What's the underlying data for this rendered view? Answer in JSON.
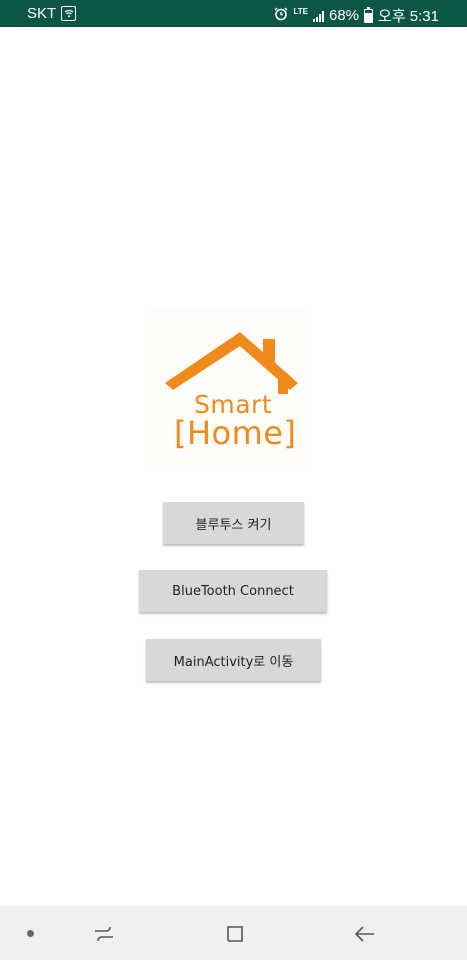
{
  "status_bar": {
    "carrier": "SKT",
    "network": "LTE",
    "battery": "68%",
    "battery_level": 0.68,
    "time": "오후 5:31",
    "icons": [
      "wifi-icon",
      "alarm-icon",
      "signal-icon",
      "battery-icon"
    ]
  },
  "logo": {
    "line1": "Smart",
    "line2": "[Home]",
    "color": "#ef8a1b"
  },
  "buttons": {
    "bluetooth_on": "블루투스 켜기",
    "bluetooth_connect": "BlueTooth Connect",
    "go_main": "MainActivity로 이동"
  },
  "nav_bar": {
    "items": [
      "dot-icon",
      "recent-apps-icon",
      "home-icon",
      "back-icon"
    ]
  },
  "colors": {
    "status_bar": "#0b5647",
    "button": "#d8d8d8",
    "nav_bar": "#f0f0f0"
  }
}
